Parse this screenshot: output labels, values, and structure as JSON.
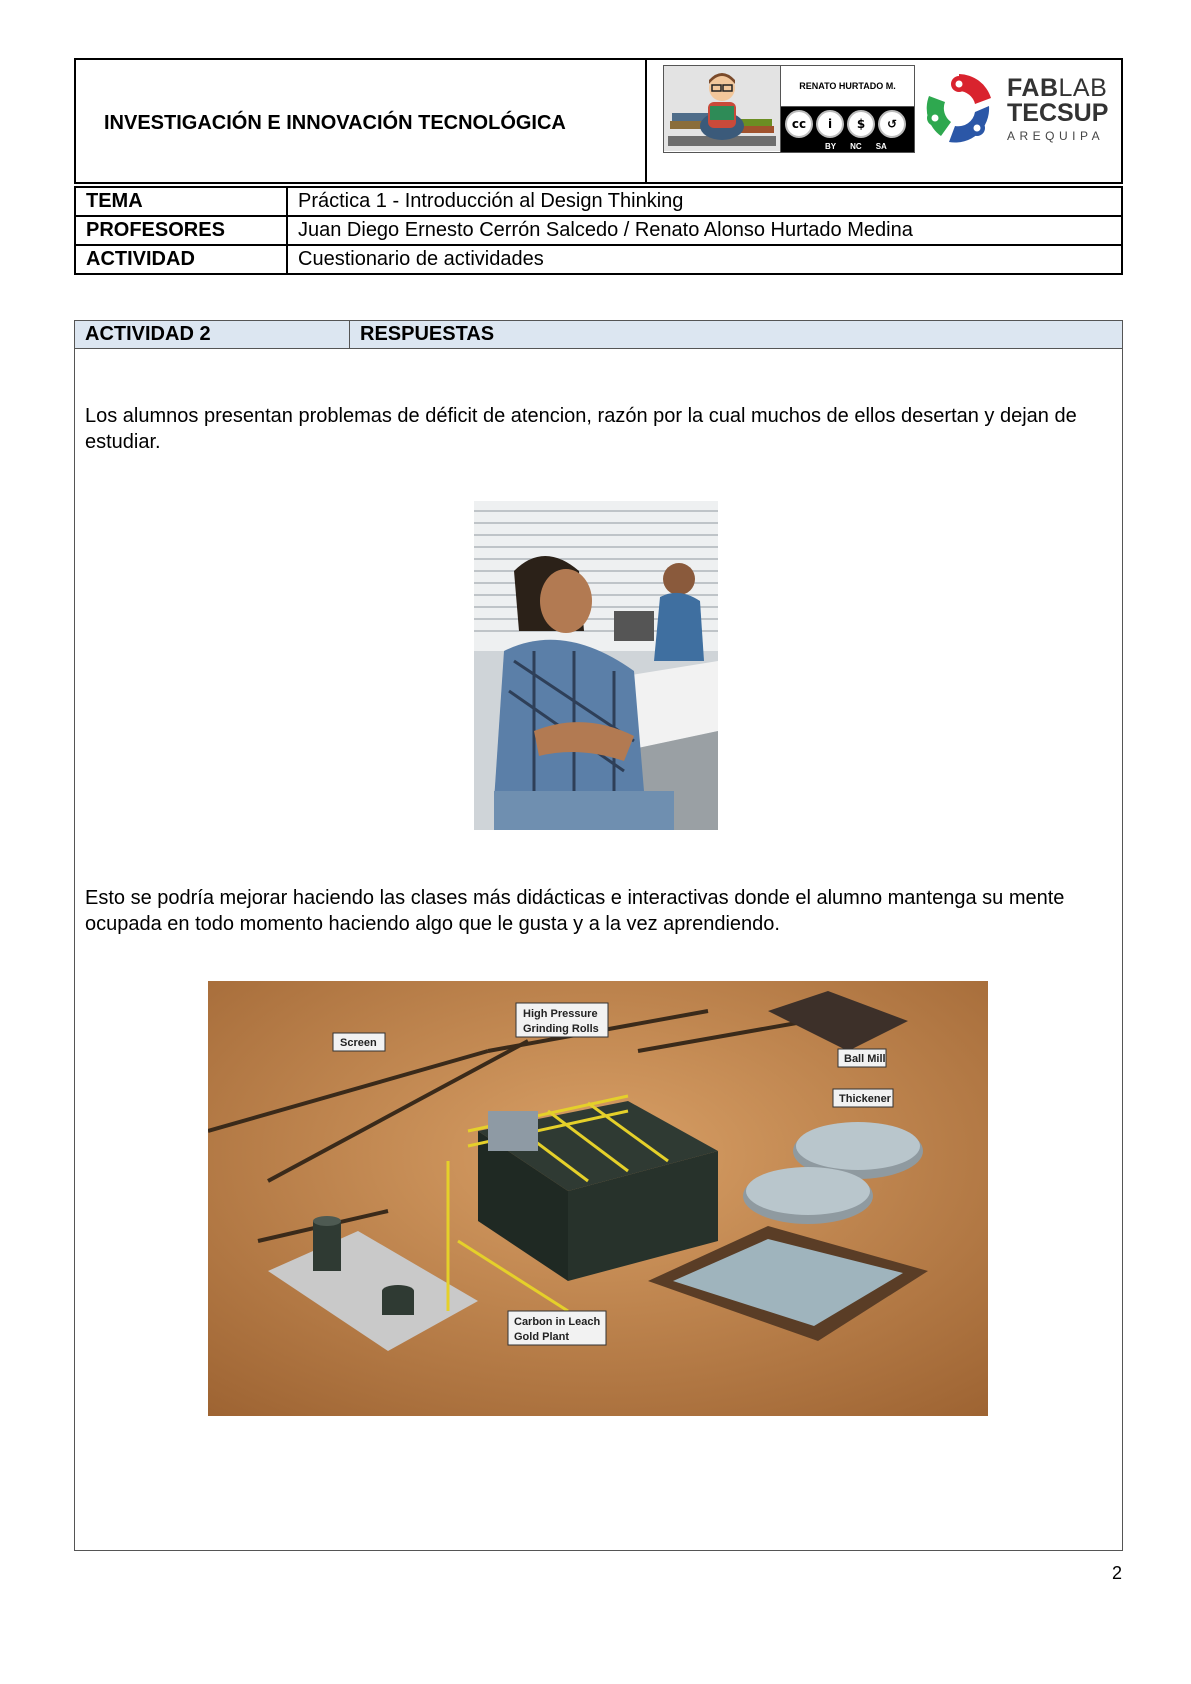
{
  "header": {
    "title": "INVESTIGACIÓN E INNOVACIÓN TECNOLÓGICA",
    "author_badge": {
      "name": "RENATO HURTADO M.",
      "license_icons": [
        "cc-icon",
        "by-icon",
        "nc-icon",
        "sa-icon"
      ],
      "license_labels": [
        "BY",
        "NC",
        "SA"
      ]
    },
    "logo": {
      "line1_bold": "FAB",
      "line1_rest": "LAB",
      "line2": "TECSUP",
      "line3": "AREQUIPA",
      "colors": [
        "#d9232e",
        "#2ea84f",
        "#2b57a7"
      ]
    }
  },
  "info_rows": [
    {
      "label": "TEMA",
      "value": "Práctica 1 - Introducción al Design Thinking"
    },
    {
      "label": "PROFESORES",
      "value": "Juan Diego Ernesto Cerrón Salcedo / Renato Alonso Hurtado Medina"
    },
    {
      "label": "ACTIVIDAD",
      "value": "Cuestionario de actividades"
    }
  ],
  "activity": {
    "header_left": "ACTIVIDAD 2",
    "header_right": "RESPUESTAS",
    "header_bg": "#dce6f1",
    "paragraph1": " Los alumnos presentan problemas de déficit de atencion, razón por la cual muchos de ellos desertan y dejan de estudiar.",
    "paragraph2": " Esto se podría mejorar haciendo las clases más didácticas e interactivas donde el alumno mantenga su mente ocupada en todo momento haciendo algo que le gusta y a la vez aprendiendo.",
    "plant_labels": {
      "screen": "Screen",
      "hpgr_line1": "High Pressure",
      "hpgr_line2": "Grinding Rolls",
      "ball_mill": "Ball Mill",
      "thickener": "Thickener",
      "cil_line1": "Carbon in Leach",
      "cil_line2": "Gold Plant"
    }
  },
  "page_number": "2"
}
